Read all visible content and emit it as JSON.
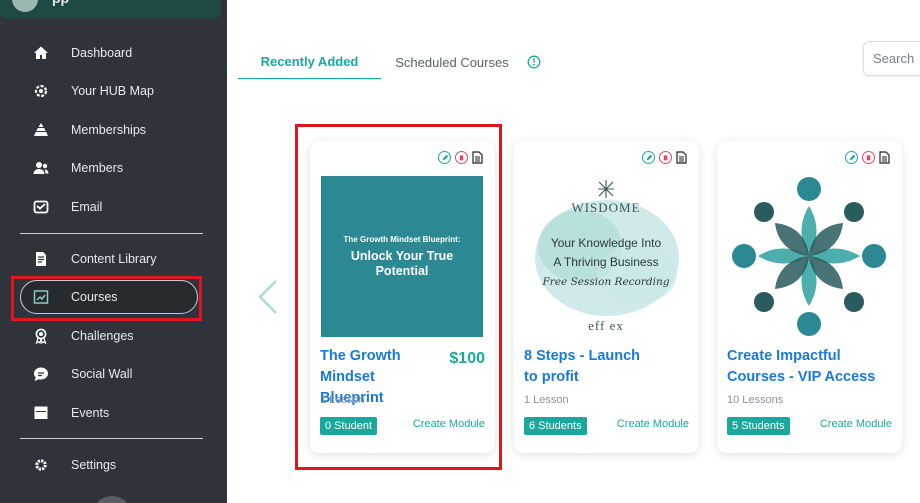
{
  "app": {
    "name": "pp"
  },
  "sidebar": {
    "items": [
      {
        "label": "Dashboard",
        "icon": "home-icon"
      },
      {
        "label": "Your HUB Map",
        "icon": "gear-map-icon"
      },
      {
        "label": "Memberships",
        "icon": "pyramid-icon"
      },
      {
        "label": "Members",
        "icon": "users-icon"
      },
      {
        "label": "Email",
        "icon": "email-icon"
      },
      {
        "label": "Content Library",
        "icon": "document-icon"
      },
      {
        "label": "Courses",
        "icon": "chart-board-icon"
      },
      {
        "label": "Challenges",
        "icon": "award-icon"
      },
      {
        "label": "Social Wall",
        "icon": "chat-bubble-icon"
      },
      {
        "label": "Events",
        "icon": "calendar-icon"
      },
      {
        "label": "Settings",
        "icon": "settings-gear-icon"
      }
    ],
    "active": "Courses"
  },
  "tabs": {
    "recent": "Recently Added",
    "scheduled": "Scheduled Courses"
  },
  "search": {
    "placeholder": "Search"
  },
  "courses": [
    {
      "title": "The Growth Mindset Blueprint",
      "price": "$100",
      "lessons": "1 Lesson",
      "students": "0 Student",
      "action": "Create Module",
      "thumb": {
        "small": "The Growth Mindset Blueprint:",
        "big": "Unlock Your True Potential"
      }
    },
    {
      "title": "8 Steps - Launch to profit",
      "price": "",
      "lessons": "1 Lesson",
      "students": "6 Students",
      "action": "Create Module",
      "thumb": {
        "brand": "WISDOME",
        "line1": "Your Knowledge Into",
        "line2": "A Thriving Business",
        "script": "Free Session Recording",
        "sig": "eff ex"
      }
    },
    {
      "title": "Create Impactful Courses - VIP Access",
      "price": "",
      "lessons": "10 Lessons",
      "students": "5 Students",
      "action": "Create Module"
    }
  ],
  "colors": {
    "accent": "#1aa89c",
    "link": "#1a78d6",
    "sidebar": "#2f343a",
    "highlight": "#e0161e"
  }
}
